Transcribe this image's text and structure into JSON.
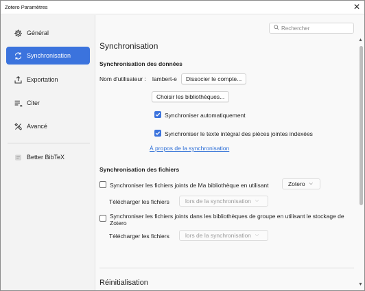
{
  "window": {
    "title": "Zotero Paramètres",
    "close_glyph": "✕"
  },
  "sidebar": {
    "items": [
      {
        "label": "Général",
        "icon": "gear-icon"
      },
      {
        "label": "Synchronisation",
        "icon": "sync-icon",
        "active": true
      },
      {
        "label": "Exportation",
        "icon": "export-icon"
      },
      {
        "label": "Citer",
        "icon": "cite-icon"
      },
      {
        "label": "Avancé",
        "icon": "tools-icon"
      },
      {
        "label": "Better BibTeX",
        "icon": "bbt-icon"
      }
    ]
  },
  "search": {
    "placeholder": "Rechercher"
  },
  "sync": {
    "title": "Synchronisation",
    "data_heading": "Synchronisation des données",
    "username_label": "Nom d'utilisateur :",
    "username_value": "lambert-e",
    "unlink_button": "Dissocier le compte...",
    "choose_libraries_button": "Choisir les bibliothèques...",
    "auto_sync_label": "Synchroniser automatiquement",
    "auto_sync_checked": true,
    "fulltext_label": "Synchroniser le texte intégral des pièces jointes indexées",
    "fulltext_checked": true,
    "about_link": "À propos de la synchronisation",
    "files_heading": "Synchronisation des fichiers",
    "my_library_label": "Synchroniser les fichiers joints de Ma bibliothèque en utilisant",
    "my_library_checked": false,
    "my_library_service": "Zotero",
    "download_label": "Télécharger les fichiers",
    "download_value": "lors de la synchronisation",
    "group_label_line1": "Synchroniser les fichiers joints dans les bibliothèques de groupe en utilisant le stockage de",
    "group_label_line2": "Zotero",
    "group_checked": false,
    "download_label2": "Télécharger les fichiers",
    "download_value2": "lors de la synchronisation",
    "reset_heading": "Réinitialisation"
  },
  "colors": {
    "accent": "#3b73dd",
    "link": "#2a6cd6"
  }
}
